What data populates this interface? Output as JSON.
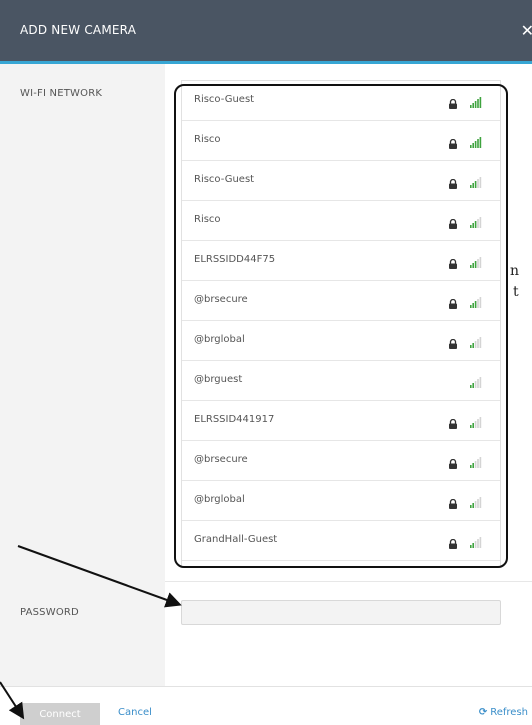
{
  "header": {
    "title": "ADD NEW CAMERA",
    "close_icon": "close-icon",
    "background": "#4a5563",
    "accent": "#37a6d4"
  },
  "wifi": {
    "label": "WI-FI NETWORK",
    "networks": [
      {
        "ssid": "Risco-Guest",
        "locked": true,
        "signal": 4
      },
      {
        "ssid": "Risco",
        "locked": true,
        "signal": 4
      },
      {
        "ssid": "Risco-Guest",
        "locked": true,
        "signal": 2
      },
      {
        "ssid": "Risco",
        "locked": true,
        "signal": 2
      },
      {
        "ssid": "ELRSSIDD44F75",
        "locked": true,
        "signal": 2
      },
      {
        "ssid": "@brsecure",
        "locked": true,
        "signal": 2
      },
      {
        "ssid": "@brglobal",
        "locked": true,
        "signal": 1
      },
      {
        "ssid": "@brguest",
        "locked": false,
        "signal": 1
      },
      {
        "ssid": "ELRSSID441917",
        "locked": true,
        "signal": 1
      },
      {
        "ssid": "@brsecure",
        "locked": true,
        "signal": 1
      },
      {
        "ssid": "@brglobal",
        "locked": true,
        "signal": 1
      },
      {
        "ssid": "GrandHall-Guest",
        "locked": true,
        "signal": 1
      }
    ]
  },
  "password": {
    "label": "PASSWORD",
    "value": "",
    "placeholder": ""
  },
  "footer": {
    "connect_label": "Connect",
    "cancel_label": "Cancel",
    "refresh_label": "Refresh",
    "link_color": "#3a8ec9"
  },
  "overlay_text": {
    "line1": "n",
    "line2": "t"
  }
}
